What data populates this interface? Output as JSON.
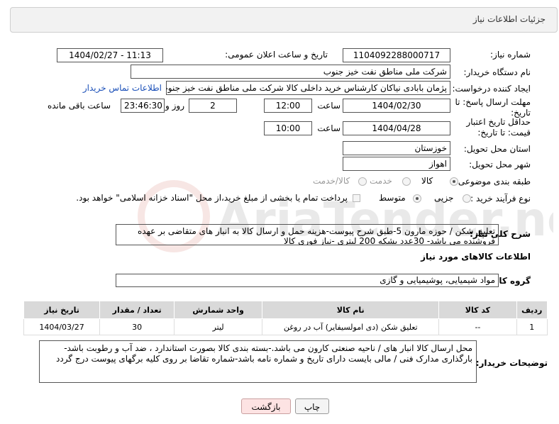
{
  "header": {
    "title": "جزئیات اطلاعات نیاز"
  },
  "fields": {
    "need_number_label": "شماره نیاز:",
    "need_number": "1104092288000717",
    "announce_label": "تاریخ و ساعت اعلان عمومی:",
    "announce_value": "1404/02/27 - 11:13",
    "buyer_org_label": "نام دستگاه خریدار:",
    "buyer_org": "شرکت ملی مناطق نفت خیز جنوب",
    "requester_label": "ایجاد کننده درخواست:",
    "requester": "پژمان  بابادی نیاکان  کارشناس خرید داخلی کالا  شرکت ملی مناطق نفت خیز جنوب",
    "contact_link": "اطلاعات تماس خریدار",
    "deadline_label": "مهلت ارسال پاسخ: تا تاریخ:",
    "deadline_date": "1404/02/30",
    "time_label": "ساعت",
    "deadline_time": "12:00",
    "days_value": "2",
    "days_label": "روز و",
    "remaining_time": "23:46:30",
    "remaining_label": "ساعت باقی مانده",
    "price_validity_label": "حداقل تاریخ اعتبار قیمت: تا تاریخ:",
    "price_validity_date": "1404/04/28",
    "price_validity_time": "10:00",
    "province_label": "استان محل تحویل:",
    "province": "خوزستان",
    "city_label": "شهر محل تحویل:",
    "city": "اهواز",
    "category_label": "طبقه بندی موضوعی:",
    "category_options": [
      "کالا",
      "خدمت",
      "کالا/خدمت"
    ],
    "process_label": "نوع فرآیند خرید :",
    "process_options": [
      "جزیی",
      "متوسط"
    ],
    "payment_note": "پرداخت تمام یا بخشی از مبلغ خرید،از محل \"اسناد خزانه اسلامی\" خواهد بود.",
    "summary_label": "شرح کلی نیاز:",
    "summary": "تعلیق شکن / حوزه مارون 5-طبق شرح پیوست-هزینه حمل و ارسال کالا به انبار های  متقاضی بر عهده فروشنده می باشد- 30عدد بشکه 200 لیتری -نیاز فوری کالا",
    "goods_info_title": "اطلاعات کالاهای مورد نیاز",
    "goods_group_label": "گروه کالا:",
    "goods_group": "مواد شیمیایی، پوشیمیایی و  گازی",
    "buyer_notes_label": "توضیحات خریدار:",
    "buyer_notes": "محل ارسال کالا انبار های / ناحیه صنعتی کارون می باشد.-بسته بندی کالا بصورت استاندارد ، ضد آب و رطوبت باشد-بارگذاری مدارک  فنی / مالی بایست دارای تاریخ و شماره نامه باشد-شماره تقاضا بر روی کلیه برگهای پیوست درج گردد"
  },
  "table": {
    "headers": [
      "ردیف",
      "کد کالا",
      "نام کالا",
      "واحد شمارش",
      "تعداد / مقدار",
      "تاریخ نیاز"
    ],
    "rows": [
      [
        "1",
        "--",
        "تعلیق شکن (دی امولسیفایر) آب در روغن",
        "لیتر",
        "30",
        "1404/03/27"
      ]
    ]
  },
  "buttons": {
    "print": "چاپ",
    "back": "بازگشت"
  },
  "watermark": "AriaTender.net"
}
